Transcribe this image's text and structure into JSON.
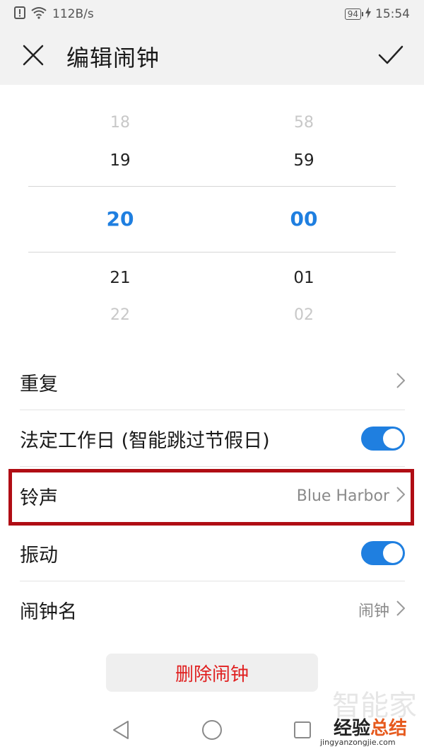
{
  "status_bar": {
    "net_speed": "112B/s",
    "battery": "94",
    "time": "15:54",
    "icons": [
      "alert-icon",
      "wifi-icon",
      "battery-icon",
      "charging-icon"
    ]
  },
  "app_bar": {
    "title": "编辑闹钟",
    "close_icon": "close-icon",
    "confirm_icon": "check-icon"
  },
  "time_picker": {
    "hours": [
      "18",
      "19",
      "20",
      "21",
      "22"
    ],
    "minutes": [
      "58",
      "59",
      "00",
      "01",
      "02"
    ],
    "selected_hour": "20",
    "selected_minute": "00",
    "selected_color": "#1f7fe0"
  },
  "settings": {
    "repeat_label": "重复",
    "workday_label": "法定工作日 (智能跳过节假日)",
    "workday_enabled": true,
    "ringtone_label": "铃声",
    "ringtone_value": "Blue Harbor",
    "vibrate_label": "振动",
    "vibrate_enabled": true,
    "alarm_name_label": "闹钟名",
    "alarm_name_value": "闹钟"
  },
  "delete_button": {
    "label": "删除闹钟",
    "color": "#e02020"
  },
  "highlight_color": "#b00d14",
  "nav_bar": {
    "icons": [
      "back-icon",
      "home-icon",
      "recents-icon"
    ]
  },
  "watermark": {
    "ghost": "智能家",
    "main_part1": "经验",
    "main_part2": "总结",
    "url": "jingyanzongjie.com"
  }
}
